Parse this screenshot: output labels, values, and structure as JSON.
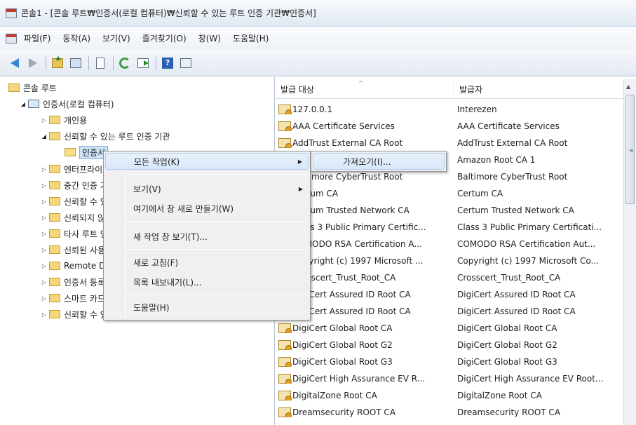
{
  "window": {
    "title": "콘솔1 - [콘솔 루트₩인증서(로컬 컴퓨터)₩신뢰할 수 있는 루트 인증 기관₩인증서]"
  },
  "menubar": {
    "items": [
      "파일(F)",
      "동작(A)",
      "보기(V)",
      "즐겨찾기(O)",
      "창(W)",
      "도움말(H)"
    ]
  },
  "toolbar": {
    "icons": [
      "back-arrow-icon",
      "forward-arrow-icon",
      "up-folder-icon",
      "show-hide-tree-icon",
      "clipboard-icon",
      "refresh-icon",
      "export-list-icon",
      "help-icon",
      "properties-icon"
    ]
  },
  "tree": {
    "root": "콘솔 루트",
    "certs": "인증서(로컬 컴퓨터)",
    "personal": "개인용",
    "trusted_root": "신뢰할 수 있는 루트 인증 기관",
    "certificates": "인증서",
    "enterprise": "엔터프라이즈 트러스트",
    "intermediate": "중간 인증 기관",
    "trusted_publishers": "신뢰할 수 있는 게시자",
    "untrusted": "신뢰되지 않은 인증서",
    "third_party": "타사 루트 인증 기관",
    "trusted_people": "신뢰된 사용자",
    "remote_desktop": "Remote Desktop",
    "enrollment": "인증서 등록 요청",
    "smartcard": "스마트 카드 신뢰할 수 있는 루트",
    "trusted_devices": "신뢰할 수 있는 장치"
  },
  "list": {
    "col_issued_to": "발급 대상",
    "col_issued_by": "발급자",
    "rows": [
      {
        "issued_to": "127.0.0.1",
        "issued_by": "Interezen"
      },
      {
        "issued_to": "AAA Certificate Services",
        "issued_by": "AAA Certificate Services"
      },
      {
        "issued_to": "AddTrust External CA Root",
        "issued_by": "AddTrust External CA Root"
      },
      {
        "issued_to": "Amazon Root CA 1",
        "issued_by": "Amazon Root CA 1"
      },
      {
        "issued_to": "Baltimore CyberTrust Root",
        "issued_by": "Baltimore CyberTrust Root"
      },
      {
        "issued_to": "Certum CA",
        "issued_by": "Certum CA"
      },
      {
        "issued_to": "Certum Trusted Network CA",
        "issued_by": "Certum Trusted Network CA"
      },
      {
        "issued_to": "Class 3 Public Primary Certific...",
        "issued_by": "Class 3 Public Primary Certificati..."
      },
      {
        "issued_to": "COMODO RSA Certification A...",
        "issued_by": "COMODO RSA Certification Aut..."
      },
      {
        "issued_to": "Copyright (c) 1997 Microsoft ...",
        "issued_by": "Copyright (c) 1997 Microsoft Co..."
      },
      {
        "issued_to": "Crosscert_Trust_Root_CA",
        "issued_by": "Crosscert_Trust_Root_CA"
      },
      {
        "issued_to": "DigiCert Assured ID Root CA",
        "issued_by": "DigiCert Assured ID Root CA"
      },
      {
        "issued_to": "DigiCert Assured ID Root CA",
        "issued_by": "DigiCert Assured ID Root CA"
      },
      {
        "issued_to": "DigiCert Global Root CA",
        "issued_by": "DigiCert Global Root CA"
      },
      {
        "issued_to": "DigiCert Global Root G2",
        "issued_by": "DigiCert Global Root G2"
      },
      {
        "issued_to": "DigiCert Global Root G3",
        "issued_by": "DigiCert Global Root G3"
      },
      {
        "issued_to": "DigiCert High Assurance EV R...",
        "issued_by": "DigiCert High Assurance EV Root..."
      },
      {
        "issued_to": "DigitalZone Root CA",
        "issued_by": "DigitalZone Root CA"
      },
      {
        "issued_to": "Dreamsecurity ROOT CA",
        "issued_by": "Dreamsecurity ROOT CA"
      }
    ]
  },
  "context_menu": {
    "all_tasks": "모든 작업(K)",
    "view": "보기(V)",
    "new_window_from_here": "여기에서 창 새로 만들기(W)",
    "new_taskpad_view": "새 작업 창 보기(T)...",
    "refresh": "새로 고침(F)",
    "export_list": "목록 내보내기(L)...",
    "help": "도움말(H)"
  },
  "submenu": {
    "import": "가져오기(I)..."
  },
  "colors": {
    "highlight": "#cde3f8",
    "menu_bg": "#f0f0f0",
    "title_bg": "#dfe8f3"
  }
}
